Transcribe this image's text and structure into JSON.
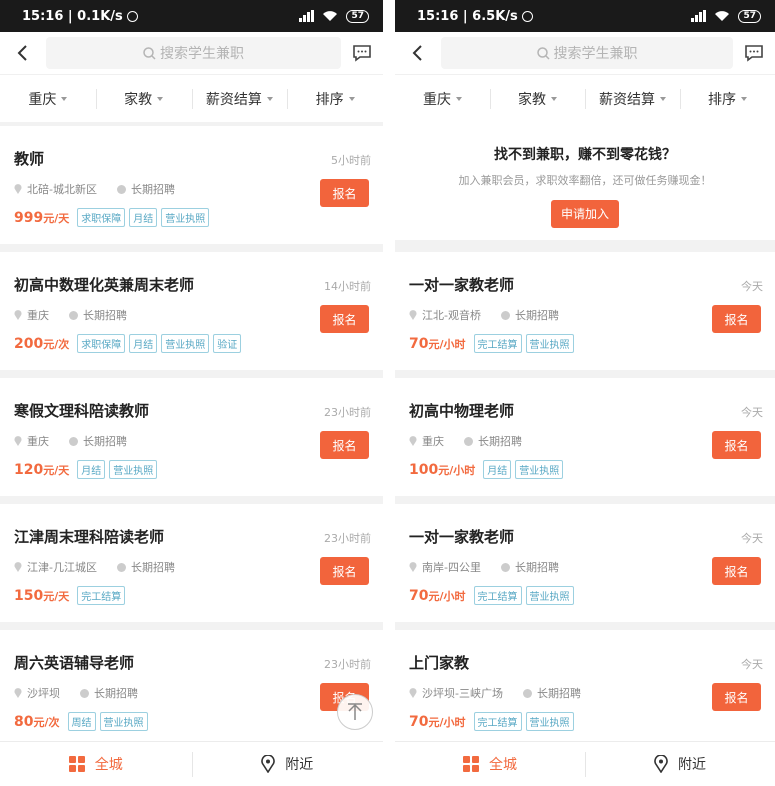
{
  "colors": {
    "accent": "#f2643c",
    "tag": "#58a8c4",
    "status_bar": "#1a1a1a"
  },
  "left": {
    "status": {
      "time": "15:16 | 0.1K/s",
      "battery": "57"
    },
    "search": {
      "placeholder": "搜索学生兼职"
    },
    "filters": [
      "重庆",
      "家教",
      "薪资结算",
      "排序"
    ],
    "jobs": [
      {
        "title": "教师",
        "time": "5小时前",
        "location": "北碚-城北新区",
        "recruit": "长期招聘",
        "salary": "999",
        "unit": "元/天",
        "tags": [
          "求职保障",
          "月结",
          "营业执照"
        ],
        "apply": "报名"
      },
      {
        "title": "初高中数理化英兼周末老师",
        "time": "14小时前",
        "location": "重庆",
        "recruit": "长期招聘",
        "salary": "200",
        "unit": "元/次",
        "tags": [
          "求职保障",
          "月结",
          "营业执照",
          "验证"
        ],
        "apply": "报名"
      },
      {
        "title": "寒假文理科陪读教师",
        "time": "23小时前",
        "location": "重庆",
        "recruit": "长期招聘",
        "salary": "120",
        "unit": "元/天",
        "tags": [
          "月结",
          "营业执照"
        ],
        "apply": "报名"
      },
      {
        "title": "江津周末理科陪读老师",
        "time": "23小时前",
        "location": "江津-几江城区",
        "recruit": "长期招聘",
        "salary": "150",
        "unit": "元/天",
        "tags": [
          "完工结算"
        ],
        "apply": "报名"
      },
      {
        "title": "周六英语辅导老师",
        "time": "23小时前",
        "location": "沙坪坝",
        "recruit": "长期招聘",
        "salary": "80",
        "unit": "元/次",
        "tags": [
          "周结",
          "营业执照"
        ],
        "apply": "报名"
      }
    ],
    "nav": {
      "all_city": "全城",
      "nearby": "附近"
    }
  },
  "right": {
    "status": {
      "time": "15:16 | 6.5K/s",
      "battery": "57"
    },
    "search": {
      "placeholder": "搜索学生兼职"
    },
    "filters": [
      "重庆",
      "家教",
      "薪资结算",
      "排序"
    ],
    "promo": {
      "title": "找不到兼职，赚不到零花钱？",
      "subtitle": "加入兼职会员，求职效率翻倍，还可做任务赚现金！",
      "button": "申请加入"
    },
    "jobs": [
      {
        "title": "一对一家教老师",
        "time": "今天",
        "location": "江北-观音桥",
        "recruit": "长期招聘",
        "salary": "70",
        "unit": "元/小时",
        "tags": [
          "完工结算",
          "营业执照"
        ],
        "apply": "报名"
      },
      {
        "title": "初高中物理老师",
        "time": "今天",
        "location": "重庆",
        "recruit": "长期招聘",
        "salary": "100",
        "unit": "元/小时",
        "tags": [
          "月结",
          "营业执照"
        ],
        "apply": "报名"
      },
      {
        "title": "一对一家教老师",
        "time": "今天",
        "location": "南岸-四公里",
        "recruit": "长期招聘",
        "salary": "70",
        "unit": "元/小时",
        "tags": [
          "完工结算",
          "营业执照"
        ],
        "apply": "报名"
      },
      {
        "title": "上门家教",
        "time": "今天",
        "location": "沙坪坝-三峡广场",
        "recruit": "长期招聘",
        "salary": "70",
        "unit": "元/小时",
        "tags": [
          "完工结算",
          "营业执照"
        ],
        "apply": "报名"
      }
    ],
    "nav": {
      "all_city": "全城",
      "nearby": "附近"
    }
  }
}
